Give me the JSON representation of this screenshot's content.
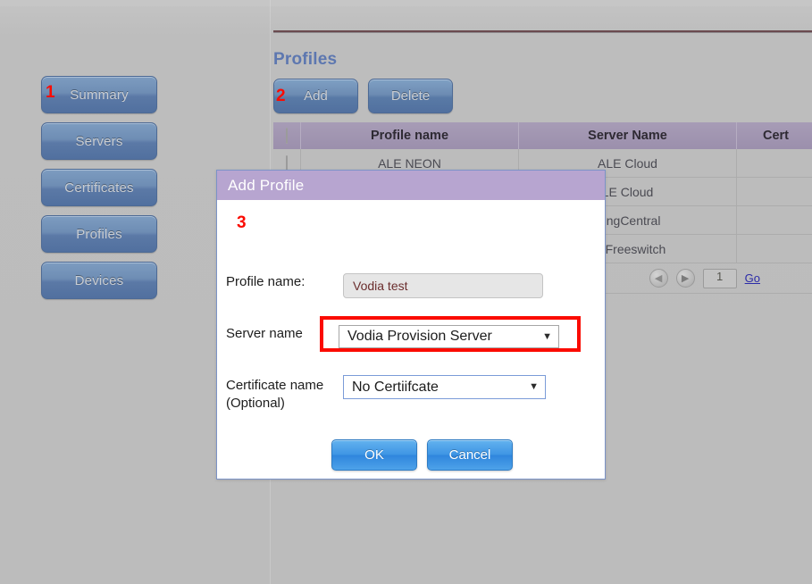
{
  "annotations": {
    "step1": "1",
    "step2": "2",
    "step3": "3",
    "color": "#fb0b02"
  },
  "sidebar": {
    "items": [
      {
        "label": "Summary"
      },
      {
        "label": "Servers"
      },
      {
        "label": "Certificates"
      },
      {
        "label": "Profiles"
      },
      {
        "label": "Devices"
      }
    ]
  },
  "main": {
    "title": "Profiles",
    "toolbar": {
      "add_label": "Add",
      "delete_label": "Delete"
    },
    "table": {
      "columns": [
        "",
        "Profile name",
        "Server Name",
        "Cert"
      ],
      "rows": [
        {
          "name": "ALE NEON",
          "server": "ALE Cloud",
          "cert": ""
        },
        {
          "name": "",
          "server": "LE Cloud",
          "cert": ""
        },
        {
          "name": "",
          "server": "RingCentral",
          "cert": ""
        },
        {
          "name": "",
          "server": "D_Freeswitch",
          "cert": ""
        }
      ]
    },
    "pager": {
      "prev_icon": "chevron-left-icon",
      "next_icon": "chevron-right-icon",
      "page_value": "1",
      "go_label": "Go"
    }
  },
  "dialog": {
    "title": "Add Profile",
    "profile_name_label": "Profile name:",
    "profile_name_value": "Vodia test",
    "server_name_label": "Server name",
    "server_name_value": "Vodia Provision Server",
    "cert_name_label": "Certificate name",
    "cert_name_label2": "(Optional)",
    "cert_name_value": "No Certiifcate",
    "ok_label": "OK",
    "cancel_label": "Cancel",
    "caret": "▼",
    "highlight_color": "#fb0b02"
  }
}
